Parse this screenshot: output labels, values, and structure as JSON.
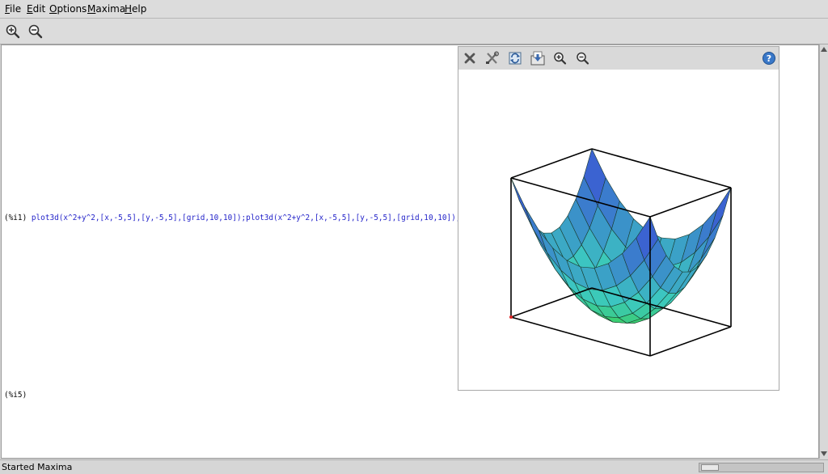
{
  "menubar": {
    "items": [
      {
        "accel": "F",
        "rest": "ile"
      },
      {
        "accel": "E",
        "rest": "dit"
      },
      {
        "accel": "O",
        "rest": "ptions"
      },
      {
        "accel": "M",
        "rest": "axima"
      },
      {
        "accel": "H",
        "rest": "elp"
      }
    ]
  },
  "toolbar": {
    "icons": [
      "zoom-in-icon",
      "zoom-out-icon"
    ]
  },
  "worksheet": {
    "cells": [
      {
        "prompt": "(%i1)",
        "input": "plot3d(x^2+y^2,[x,-5,5],[y,-5,5],[grid,10,10]);plot3d(x^2+y^2,[x,-5,5],[y,-5,5],[grid,10,10]);"
      },
      {
        "prompt": "(%i5)",
        "input": ""
      }
    ]
  },
  "plot_window": {
    "toolbar_icons": [
      "close-icon",
      "config-icon",
      "replot-icon",
      "save-icon",
      "zoom-in-icon",
      "zoom-out-icon",
      "help-icon"
    ],
    "chart_data": {
      "type": "surface3d",
      "expression": "x^2+y^2",
      "x_range": [
        -5,
        5
      ],
      "y_range": [
        -5,
        5
      ],
      "grid": [
        10,
        10
      ],
      "colors": {
        "low": "#39d23a",
        "mid": "#3cc8c0",
        "high": "#3a3ad8"
      }
    }
  },
  "statusbar": {
    "text": "Started Maxima"
  }
}
